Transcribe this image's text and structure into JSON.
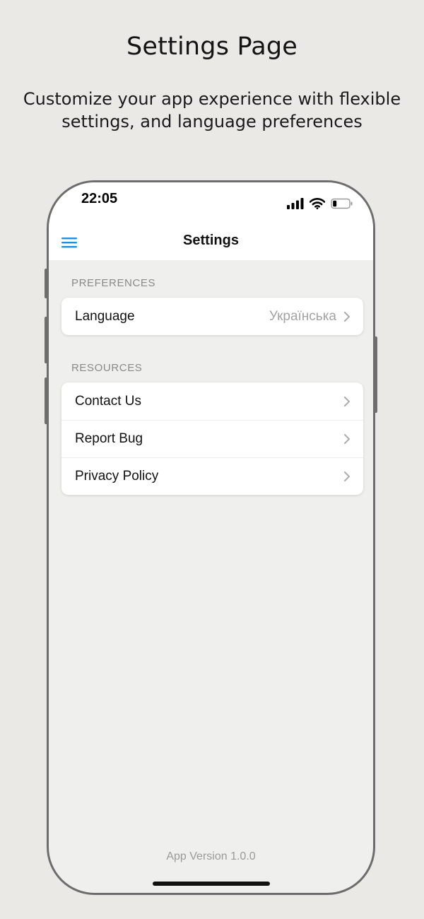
{
  "hero": {
    "title": "Settings Page",
    "subtitle": "Customize your app experience with flexible settings, and language preferences"
  },
  "status_bar": {
    "time": "22:05",
    "icons": [
      "cellular-signal-icon",
      "wifi-icon",
      "battery-icon"
    ]
  },
  "nav": {
    "menu_icon": "hamburger-menu-icon",
    "title": "Settings",
    "accent_color": "#1f8fe0"
  },
  "sections": [
    {
      "header": "PREFERENCES",
      "items": [
        {
          "label": "Language",
          "value": "Українська"
        }
      ]
    },
    {
      "header": "RESOURCES",
      "items": [
        {
          "label": "Contact Us"
        },
        {
          "label": "Report Bug"
        },
        {
          "label": "Privacy Policy"
        }
      ]
    }
  ],
  "footer": {
    "version": "App Version 1.0.0"
  }
}
